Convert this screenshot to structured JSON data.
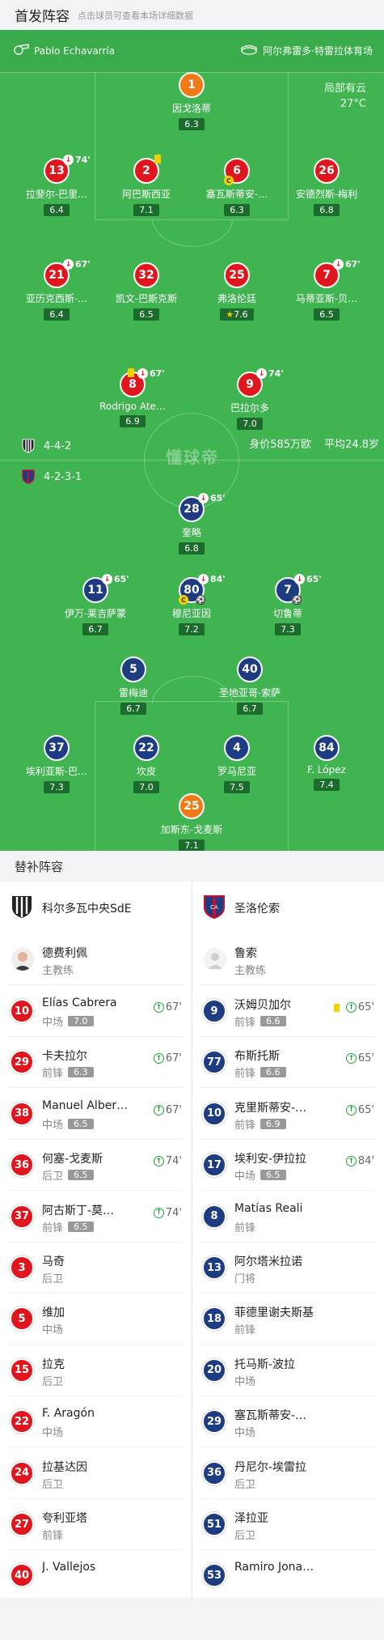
{
  "header": {
    "title": "首发阵容",
    "subtitle": "点击球员可查看本场详细数据"
  },
  "pitch": {
    "referee": "Pablo Echavarría",
    "stadium": "阿尔弗雷多·特雷拉体育场",
    "weather": "局部有云",
    "temperature": "27°C",
    "watermark": "懂球帝",
    "home": {
      "formation": "4-4-2",
      "value": "身价585万欧",
      "age": "平均24.8岁"
    },
    "away": {
      "formation": "4-2-3-1"
    },
    "home_players": [
      {
        "num": "1",
        "name": "因戈洛蒂",
        "rating": "6.3"
      },
      {
        "num": "13",
        "name": "拉斐尔-巴里…",
        "rating": "6.4",
        "sub": "74'"
      },
      {
        "num": "2",
        "name": "阿巴斯西亚",
        "rating": "7.1"
      },
      {
        "num": "6",
        "name": "塞瓦斯蒂安-…",
        "rating": "6.3"
      },
      {
        "num": "26",
        "name": "安德烈斯-梅利",
        "rating": "6.8"
      },
      {
        "num": "21",
        "name": "亚历克西斯-…",
        "rating": "6.4",
        "sub": "67'"
      },
      {
        "num": "32",
        "name": "凯文-巴斯克斯",
        "rating": "6.5"
      },
      {
        "num": "25",
        "name": "弗洛伦廷",
        "rating": "7.6"
      },
      {
        "num": "7",
        "name": "马蒂亚斯-贝…",
        "rating": "6.5",
        "sub": "67'"
      },
      {
        "num": "8",
        "name": "Rodrigo Ate…",
        "rating": "6.9",
        "sub": "67'"
      },
      {
        "num": "9",
        "name": "巴拉尔多",
        "rating": "7.0",
        "sub": "74'"
      }
    ],
    "away_players": [
      {
        "num": "28",
        "name": "奎略",
        "rating": "6.8",
        "sub": "65'"
      },
      {
        "num": "11",
        "name": "伊万-莱吉萨蒙",
        "rating": "6.7",
        "sub": "65'"
      },
      {
        "num": "80",
        "name": "穆尼亚因",
        "rating": "7.2",
        "sub": "84'"
      },
      {
        "num": "7",
        "name": "切鲁蒂",
        "rating": "7.3",
        "sub": "65'"
      },
      {
        "num": "5",
        "name": "雷梅迪",
        "rating": "6.7"
      },
      {
        "num": "40",
        "name": "圣地亚哥-索萨",
        "rating": "6.7"
      },
      {
        "num": "37",
        "name": "埃利亚斯-巴…",
        "rating": "7.3"
      },
      {
        "num": "22",
        "name": "坎皮",
        "rating": "7.0"
      },
      {
        "num": "4",
        "name": "罗马尼亚",
        "rating": "7.5"
      },
      {
        "num": "84",
        "name": "F. López",
        "rating": "7.4"
      },
      {
        "num": "25",
        "name": "加斯东-戈麦斯",
        "rating": "7.1"
      }
    ]
  },
  "bench": {
    "title": "替补阵容",
    "home_team": "科尔多瓦中央SdE",
    "away_team": "圣洛伦索",
    "home_coach": {
      "name": "德费利佩",
      "role": "主教练"
    },
    "away_coach": {
      "name": "鲁索",
      "role": "主教练"
    },
    "home": [
      {
        "num": "10",
        "name": "Elías Cabrera",
        "pos": "中场",
        "rating": "7.0",
        "sub": "67'"
      },
      {
        "num": "29",
        "name": "卡夫拉尔",
        "pos": "前锋",
        "rating": "6.3",
        "sub": "67'"
      },
      {
        "num": "38",
        "name": "Manuel Albert…",
        "pos": "中场",
        "rating": "6.5",
        "sub": "67'"
      },
      {
        "num": "36",
        "name": "何塞-戈麦斯",
        "pos": "后卫",
        "rating": "6.5",
        "sub": "74'"
      },
      {
        "num": "37",
        "name": "阿古斯丁-莫…",
        "pos": "前锋",
        "rating": "6.5",
        "sub": "74'"
      },
      {
        "num": "3",
        "name": "马奇",
        "pos": "后卫"
      },
      {
        "num": "5",
        "name": "维加",
        "pos": "中场"
      },
      {
        "num": "15",
        "name": "拉克",
        "pos": "后卫"
      },
      {
        "num": "22",
        "name": "F. Aragón",
        "pos": "中场"
      },
      {
        "num": "24",
        "name": "拉基达因",
        "pos": "后卫"
      },
      {
        "num": "27",
        "name": "夸利亚塔",
        "pos": "前锋"
      },
      {
        "num": "40",
        "name": "J. Vallejos",
        "pos": ""
      }
    ],
    "away": [
      {
        "num": "9",
        "name": "沃姆贝加尔",
        "pos": "前锋",
        "rating": "6.6",
        "sub": "65'"
      },
      {
        "num": "77",
        "name": "布斯托斯",
        "pos": "前锋",
        "rating": "6.6",
        "sub": "65'"
      },
      {
        "num": "10",
        "name": "克里斯蒂安-…",
        "pos": "前锋",
        "rating": "6.9",
        "sub": "65'"
      },
      {
        "num": "17",
        "name": "埃利安-伊拉拉",
        "pos": "中场",
        "rating": "6.5",
        "sub": "84'"
      },
      {
        "num": "8",
        "name": "Matías Reali",
        "pos": "前锋"
      },
      {
        "num": "13",
        "name": "阿尔塔米拉诺",
        "pos": "门将"
      },
      {
        "num": "18",
        "name": "菲德里谢夫斯基",
        "pos": "前锋"
      },
      {
        "num": "20",
        "name": "托马斯-波拉",
        "pos": "中场"
      },
      {
        "num": "29",
        "name": "塞瓦斯蒂安-…",
        "pos": "中场"
      },
      {
        "num": "36",
        "name": "丹尼尔-埃雷拉",
        "pos": "后卫"
      },
      {
        "num": "51",
        "name": "泽拉亚",
        "pos": "后卫"
      },
      {
        "num": "53",
        "name": "Ramiro Jona…",
        "pos": ""
      }
    ]
  },
  "colors": {
    "pitch": "#3fb451",
    "home": "#e0161f",
    "away": "#1d3c82",
    "gk": "#f07a16"
  }
}
